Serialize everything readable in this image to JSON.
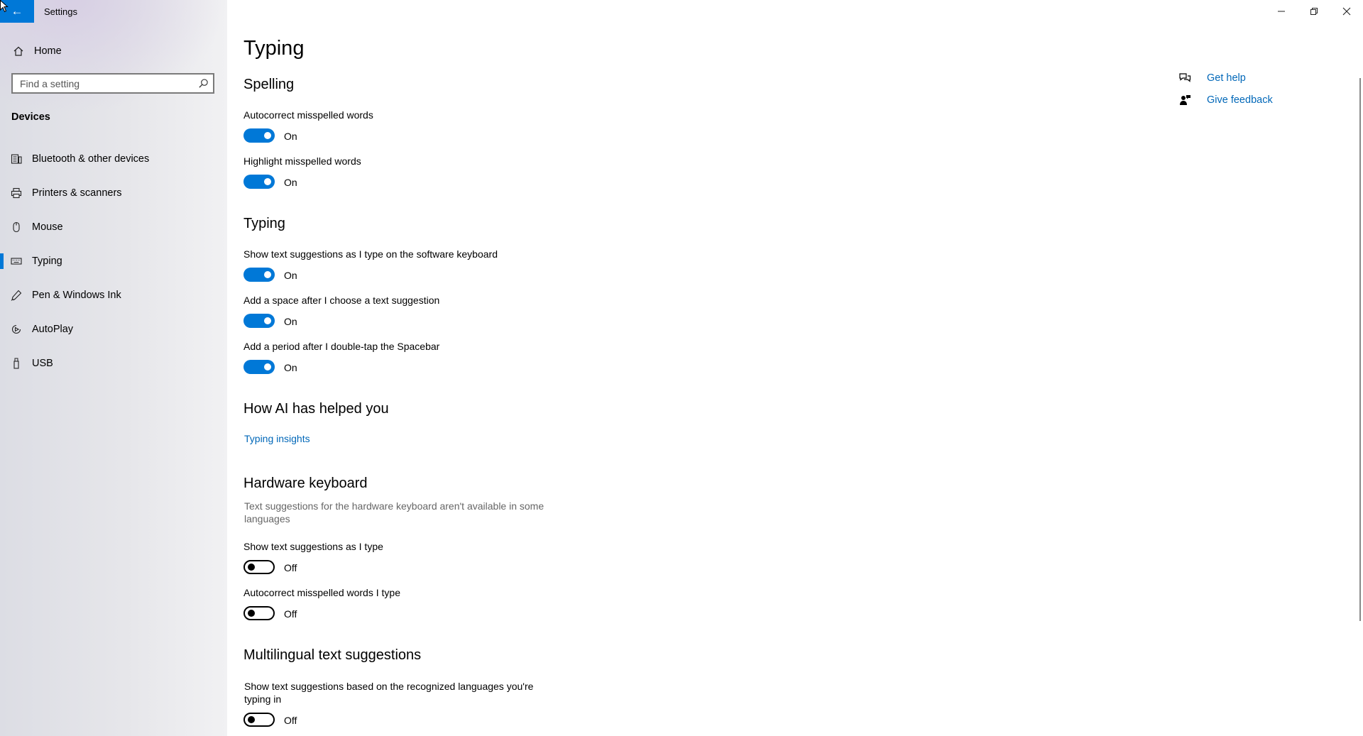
{
  "window": {
    "title": "Settings",
    "controls": {
      "minimize": "minimize-icon",
      "restore": "restore-icon",
      "close": "close-icon"
    }
  },
  "sidebar": {
    "home_label": "Home",
    "search_placeholder": "Find a setting",
    "group_title": "Devices",
    "items": [
      {
        "label": "Bluetooth & other devices",
        "icon": "bluetooth-devices-icon"
      },
      {
        "label": "Printers & scanners",
        "icon": "printer-icon"
      },
      {
        "label": "Mouse",
        "icon": "mouse-icon"
      },
      {
        "label": "Typing",
        "icon": "keyboard-icon",
        "selected": true
      },
      {
        "label": "Pen & Windows Ink",
        "icon": "pen-icon"
      },
      {
        "label": "AutoPlay",
        "icon": "autoplay-icon"
      },
      {
        "label": "USB",
        "icon": "usb-icon"
      }
    ]
  },
  "main": {
    "page_title": "Typing",
    "sections": {
      "spelling": {
        "title": "Spelling",
        "settings": [
          {
            "label": "Autocorrect misspelled words",
            "state": "On"
          },
          {
            "label": "Highlight misspelled words",
            "state": "On"
          }
        ]
      },
      "typing": {
        "title": "Typing",
        "settings": [
          {
            "label": "Show text suggestions as I type on the software keyboard",
            "state": "On"
          },
          {
            "label": "Add a space after I choose a text suggestion",
            "state": "On"
          },
          {
            "label": "Add a period after I double-tap the Spacebar",
            "state": "On"
          }
        ]
      },
      "ai": {
        "title": "How AI has helped you",
        "link": "Typing insights"
      },
      "hardware": {
        "title": "Hardware keyboard",
        "description": "Text suggestions for the hardware keyboard aren't available in some languages",
        "settings": [
          {
            "label": "Show text suggestions as I type",
            "state": "Off"
          },
          {
            "label": "Autocorrect misspelled words I type",
            "state": "Off"
          }
        ]
      },
      "multilingual": {
        "title": "Multilingual text suggestions",
        "settings": [
          {
            "label": "Show text suggestions based on the recognized languages you're typing in",
            "state": "Off"
          }
        ]
      }
    }
  },
  "related": {
    "get_help": "Get help",
    "give_feedback": "Give feedback"
  },
  "colors": {
    "accent": "#0078d7",
    "link": "#0067b8"
  }
}
